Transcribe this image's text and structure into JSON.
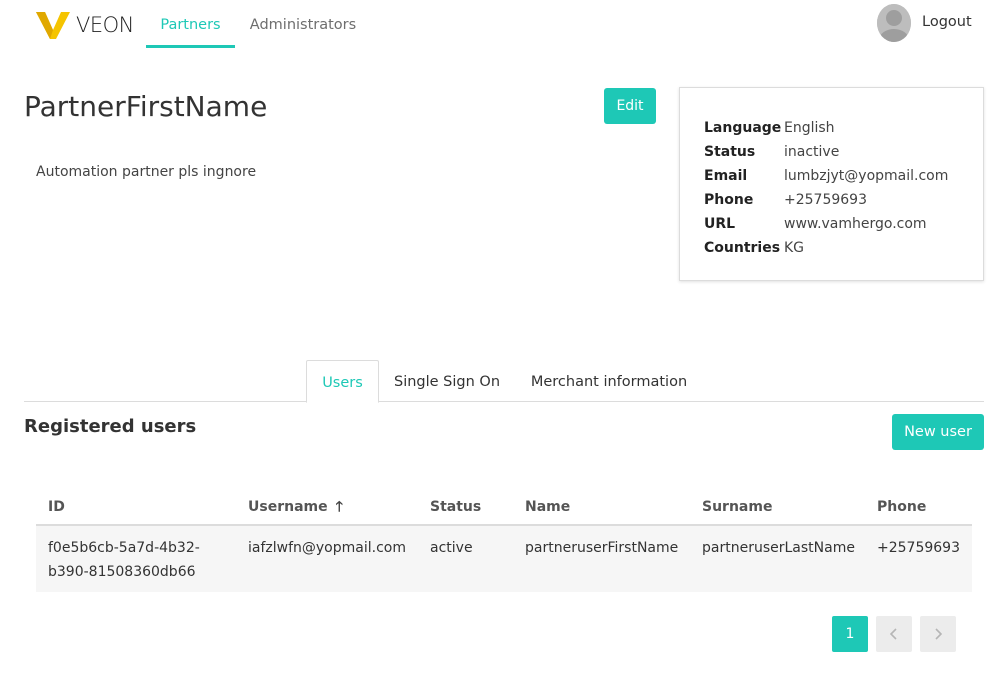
{
  "header": {
    "logo_text": "VEON",
    "nav": {
      "partners": "Partners",
      "administrators": "Administrators"
    },
    "logout": "Logout"
  },
  "partner": {
    "name": "PartnerFirstName",
    "edit_label": "Edit",
    "description": "Automation partner pls ingnore"
  },
  "details": [
    {
      "label": "Language",
      "value": "English"
    },
    {
      "label": "Status",
      "value": "inactive"
    },
    {
      "label": "Email",
      "value": "lumbzjyt@yopmail.com"
    },
    {
      "label": "Phone",
      "value": "+25759693"
    },
    {
      "label": "URL",
      "value": "www.vamhergo.com"
    },
    {
      "label": "Countries",
      "value": "KG"
    }
  ],
  "tabs": {
    "users": "Users",
    "sso": "Single Sign On",
    "merchant": "Merchant information"
  },
  "users_section": {
    "title": "Registered users",
    "new_user_label": "New user",
    "columns": {
      "id": "ID",
      "username": "Username",
      "status": "Status",
      "name": "Name",
      "surname": "Surname",
      "phone": "Phone"
    },
    "sort_icon": "arrow-up-icon",
    "rows": [
      {
        "id_line1": "f0e5b6cb-5a7d-4b32-",
        "id_line2": "b390-81508360db66",
        "username": "iafzlwfn@yopmail.com",
        "status": "active",
        "name": "partneruserFirstName",
        "surname": "partneruserLastName",
        "phone": "+25759693"
      }
    ]
  },
  "pagination": {
    "current": "1",
    "prev_icon": "chevron-left-icon",
    "next_icon": "chevron-right-icon"
  },
  "colors": {
    "accent": "#1ec8b6",
    "logo_yellow": "#f5c400"
  }
}
